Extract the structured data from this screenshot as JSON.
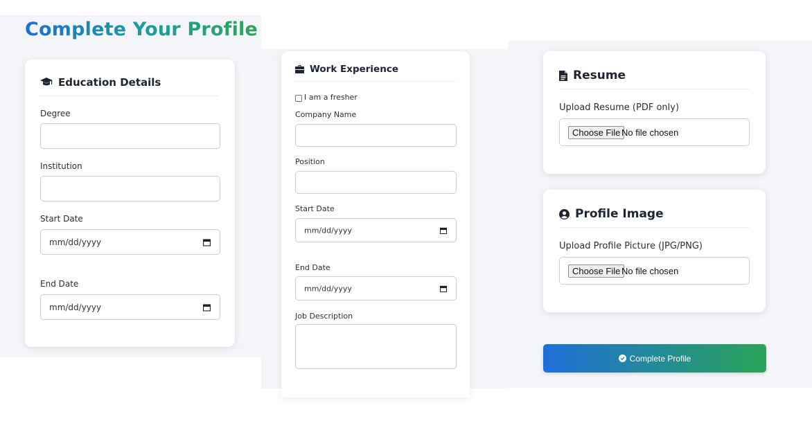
{
  "page": {
    "title": "Complete Your Profile"
  },
  "education": {
    "heading": "Education Details",
    "icon": "graduation-cap-icon",
    "degree_label": "Degree",
    "degree_value": "",
    "institution_label": "Institution",
    "institution_value": "",
    "start_date_label": "Start Date",
    "start_date_placeholder": "mm/dd/yyyy",
    "end_date_label": "End Date",
    "end_date_placeholder": "mm/dd/yyyy"
  },
  "work": {
    "heading": "Work Experience",
    "icon": "briefcase-icon",
    "fresher_label": "I am a fresher",
    "fresher_checked": false,
    "company_label": "Company Name",
    "company_value": "",
    "position_label": "Position",
    "position_value": "",
    "start_date_label": "Start Date",
    "start_date_placeholder": "mm/dd/yyyy",
    "end_date_label": "End Date",
    "end_date_placeholder": "mm/dd/yyyy",
    "description_label": "Job Description",
    "description_value": ""
  },
  "resume": {
    "heading": "Resume",
    "icon": "file-icon",
    "upload_label": "Upload Resume (PDF only)",
    "choose_button": "Choose File",
    "file_status": "No file chosen"
  },
  "profile_image": {
    "heading": "Profile Image",
    "icon": "user-circle-icon",
    "upload_label": "Upload Profile Picture (JPG/PNG)",
    "choose_button": "Choose File",
    "file_status": "No file chosen"
  },
  "submit": {
    "label": "Complete Profile",
    "icon": "check-circle-icon"
  },
  "colors": {
    "gradient_start": "#1f6fd8",
    "gradient_end": "#2aa457",
    "background": "#f3f5f8",
    "card": "#ffffff"
  }
}
